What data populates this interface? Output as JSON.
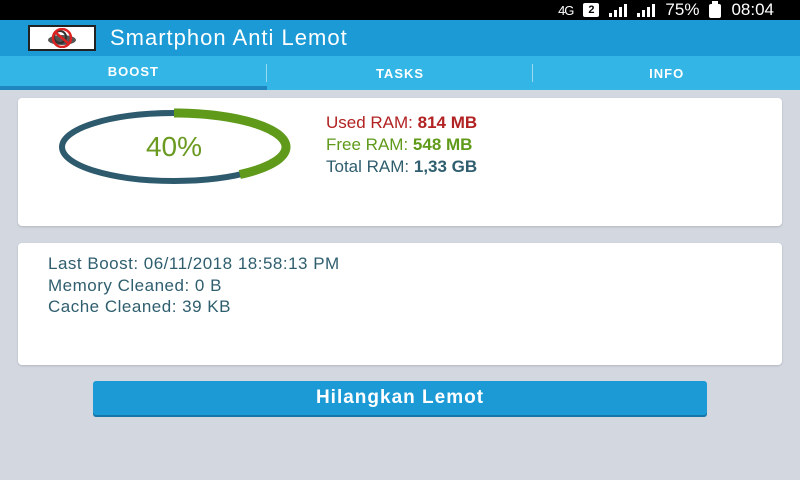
{
  "status_bar": {
    "network": "4G",
    "sim": "2",
    "battery": "75%",
    "time": "08:04"
  },
  "app_bar": {
    "title": "Smartphon Anti Lemot",
    "logo_icon": "no-snail-icon"
  },
  "tabs": [
    {
      "label": "BOOST",
      "active": true
    },
    {
      "label": "TASKS",
      "active": false
    },
    {
      "label": "INFO",
      "active": false
    }
  ],
  "ram": {
    "percent_label": "40%",
    "percent_value": 0.4,
    "used_label": "Used RAM: ",
    "used_value": "814 MB",
    "free_label": "Free RAM: ",
    "free_value": "548 MB",
    "total_label": "Total RAM: ",
    "total_value": "1,33 GB",
    "colors": {
      "used": "#b22222",
      "free": "#5f9a1a",
      "total": "#2f5e6e",
      "gauge_track": "#2e5a6e",
      "gauge_fill": "#5f9a1a"
    }
  },
  "boost_info": {
    "last_boost": "Last Boost: 06/11/2018 18:58:13 PM",
    "memory_cleaned": "Memory Cleaned: 0 B",
    "cache_cleaned": "Cache Cleaned: 39 KB"
  },
  "action": {
    "button_label": "Hilangkan Lemot",
    "accent": "#1b9ad6"
  }
}
